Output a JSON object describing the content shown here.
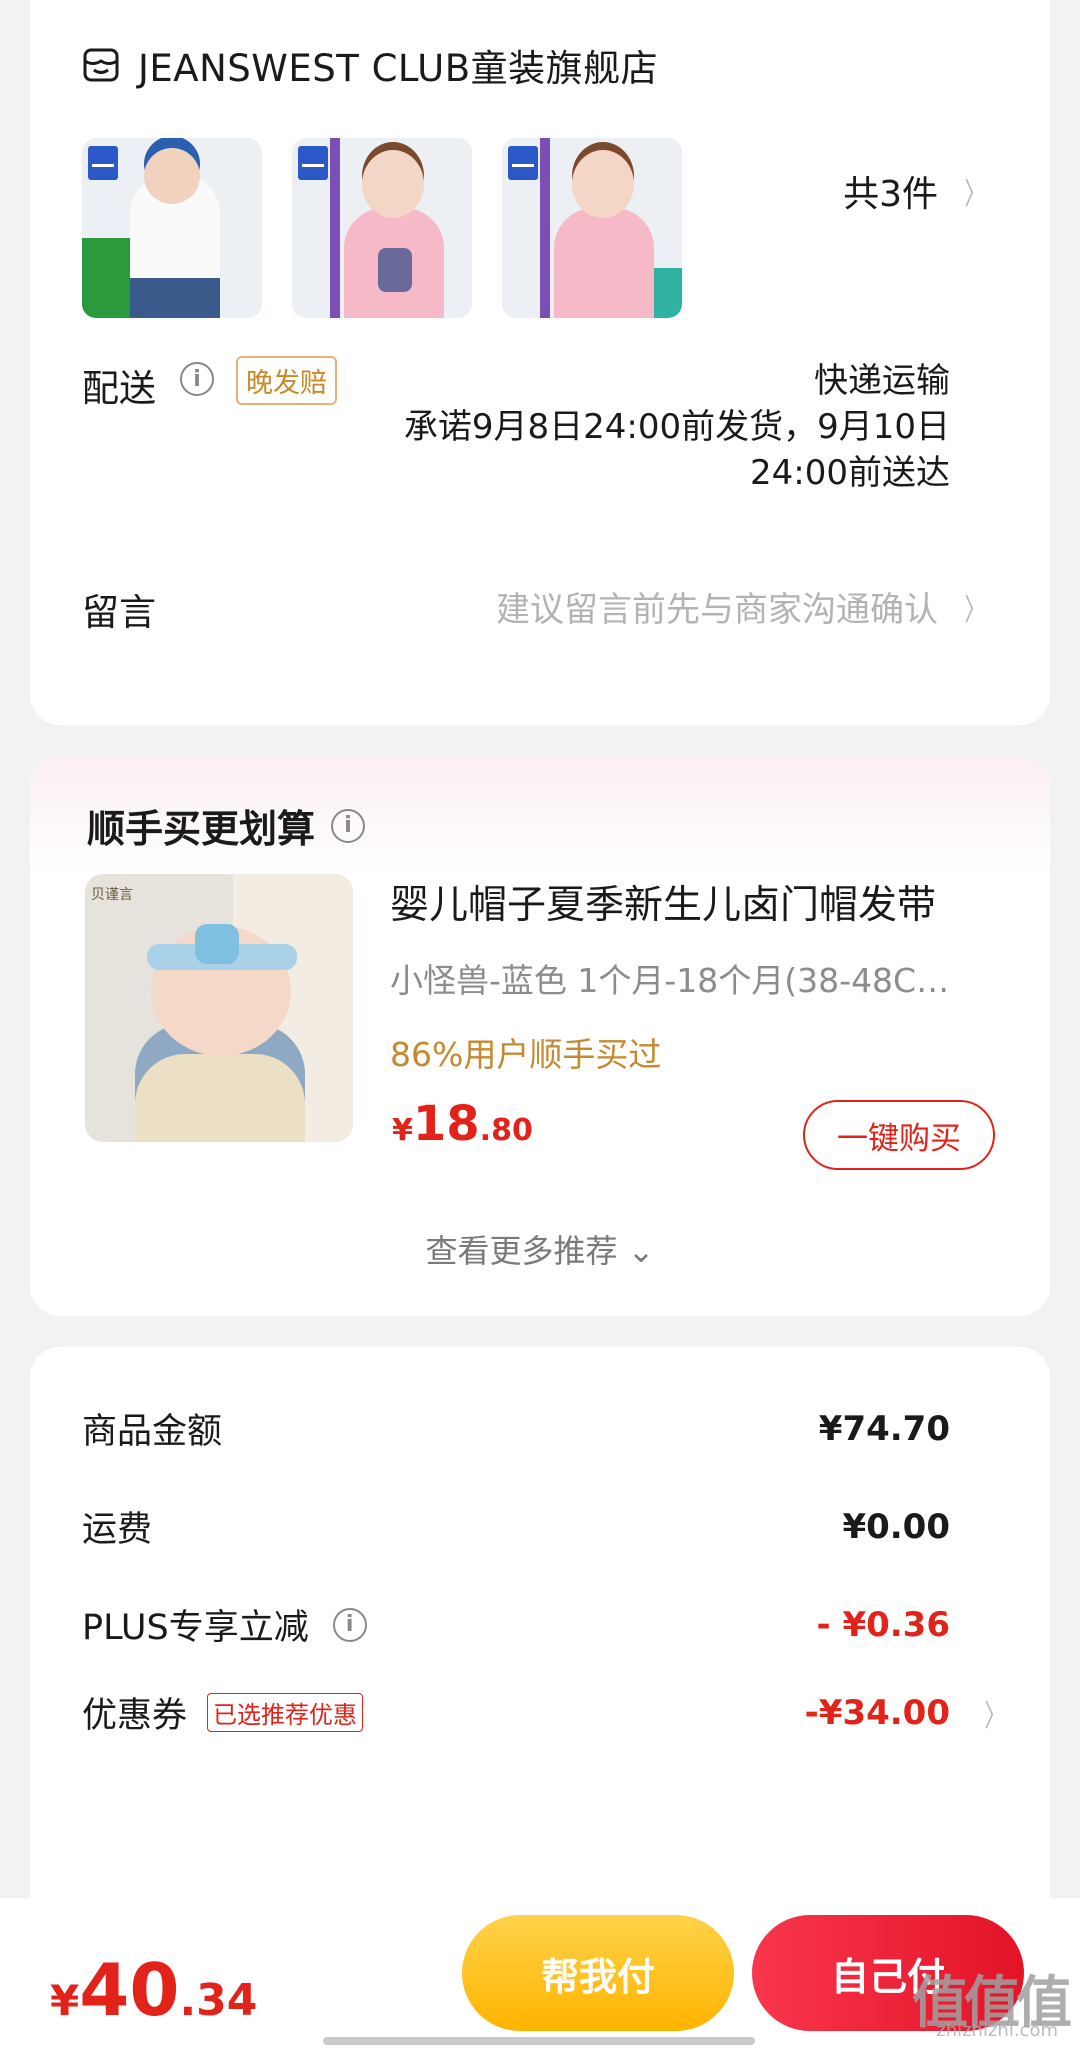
{
  "store": {
    "name": "JEANSWEST CLUB童装旗舰店",
    "item_count": "共3件",
    "chevron": "〉",
    "icon": "store-icon"
  },
  "delivery": {
    "label": "配送",
    "tag": "晚发赔",
    "method": "快递运输",
    "promise_line1": "承诺9月8日24:00前发货，9月10日",
    "promise_line2": "24:00前送达"
  },
  "message": {
    "label": "留言",
    "placeholder": "建议留言前先与商家沟通确认",
    "chevron": "〉"
  },
  "addon": {
    "title": "顺手买更划算",
    "product_name": "婴儿帽子夏季新生儿卤门帽发带",
    "spec": "小怪兽-蓝色   1个月-18个月(38-48C…",
    "social_proof": "86%用户顺手买过",
    "price_yen": "¥",
    "price_int": "18",
    "price_dec": ".80",
    "buy_label": "一键购买",
    "more_label": "查看更多推荐 ⌄",
    "image_logo": "贝谨言"
  },
  "summary": {
    "rows": [
      {
        "label": "商品金额",
        "value": "¥74.70"
      },
      {
        "label": "运费",
        "value": "¥0.00"
      },
      {
        "label": "PLUS专享立减",
        "value": "- ¥0.36"
      },
      {
        "label": "优惠券",
        "tag": "已选推荐优惠",
        "value": "-¥34.00",
        "chevron": "〉"
      }
    ]
  },
  "bottom": {
    "total_yen": "¥",
    "total_int": "40",
    "total_dec": ".34",
    "help_pay": "帮我付",
    "self_pay": "自己付"
  },
  "watermark": {
    "main": "值值值",
    "sub": "zhizhizhi.com"
  },
  "colors": {
    "accent_red": "#e2231a",
    "gold": "#c6892f",
    "help_button": "#ffb400",
    "self_button": "#f9364c"
  }
}
